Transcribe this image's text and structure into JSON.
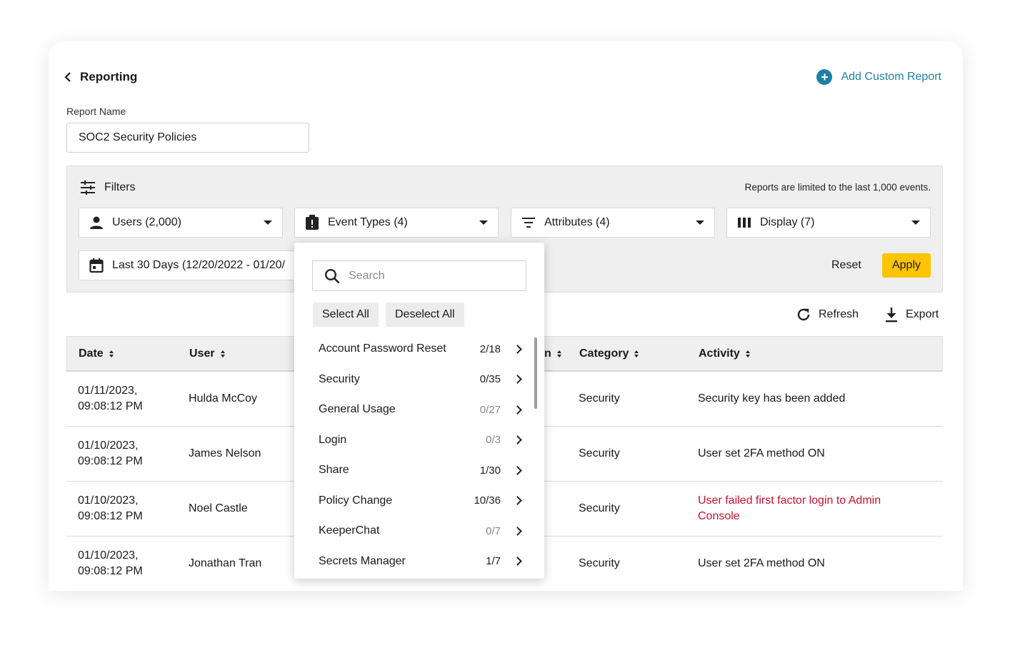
{
  "header": {
    "back_label": "Reporting",
    "add_report_label": "Add Custom Report"
  },
  "report_name": {
    "label": "Report Name",
    "value": "SOC2 Security Policies"
  },
  "filters": {
    "title": "Filters",
    "limit_note": "Reports are limited to the last 1,000 events.",
    "users": "Users (2,000)",
    "event_types": "Event Types (4)",
    "attributes": "Attributes (4)",
    "display": "Display (7)",
    "date_range": "Last 30 Days (12/20/2022 - 01/20/",
    "reset_label": "Reset",
    "apply_label": "Apply"
  },
  "actions": {
    "refresh_label": "Refresh",
    "export_label": "Export"
  },
  "table": {
    "columns": {
      "date": "Date",
      "user": "User",
      "hidden_partial": "n",
      "category": "Category",
      "activity": "Activity"
    },
    "rows": [
      {
        "date": "01/11/2023, 09:08:12 PM",
        "user": "Hulda McCoy",
        "category": "Security",
        "activity": "Security key has been added",
        "alert": false
      },
      {
        "date": "01/10/2023, 09:08:12 PM",
        "user": "James Nelson",
        "category": "Security",
        "activity": "User set 2FA method ON",
        "alert": false
      },
      {
        "date": "01/10/2023, 09:08:12 PM",
        "user": "Noel Castle",
        "category": "Security",
        "activity": "User failed first factor login to Admin Console",
        "alert": true
      },
      {
        "date": "01/10/2023, 09:08:12 PM",
        "user": "Jonathan Tran",
        "category": "Security",
        "activity": "User set 2FA method ON",
        "alert": false
      }
    ]
  },
  "event_types_popup": {
    "search_placeholder": "Search",
    "select_all_label": "Select All",
    "deselect_all_label": "Deselect All",
    "items": [
      {
        "label": "Account Password Reset",
        "count": "2/18"
      },
      {
        "label": "Security",
        "count": "0/35"
      },
      {
        "label": "General Usage",
        "count": "0/27"
      },
      {
        "label": "Login",
        "count": "0/3"
      },
      {
        "label": "Share",
        "count": "1/30"
      },
      {
        "label": "Policy Change",
        "count": "10/36"
      },
      {
        "label": "KeeperChat",
        "count": "0/7"
      },
      {
        "label": "Secrets Manager",
        "count": "1/7"
      }
    ]
  },
  "colors": {
    "accent": "#1e7fa6",
    "apply_button": "#ffc400",
    "alert_text": "#c8102e"
  }
}
